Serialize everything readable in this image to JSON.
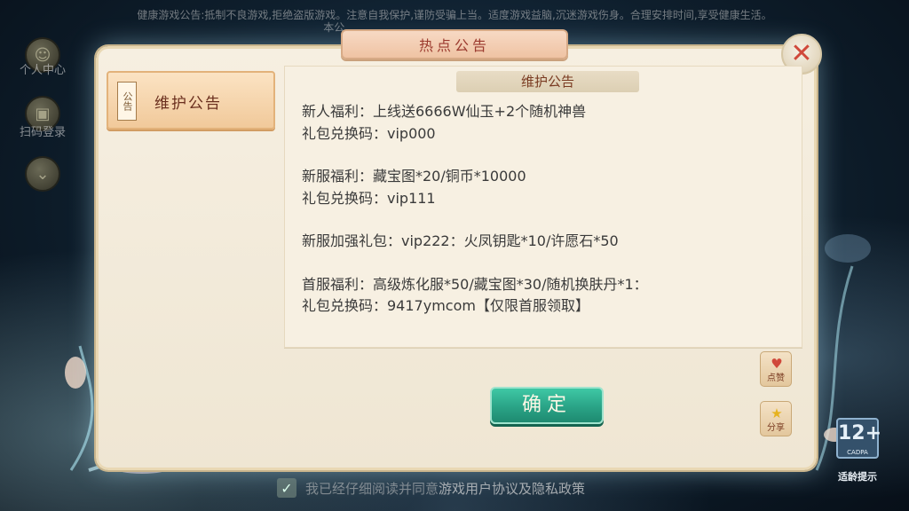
{
  "health_notice": {
    "line1": "健康游戏公告:抵制不良游戏,拒绝盗版游戏。注意自我保护,谨防受骗上当。适度游戏益脑,沉迷游戏伤身。合理安排时间,享受健康生活。",
    "line2": "本公..."
  },
  "side_menu": {
    "profile_label": "个人中心",
    "scan_label": "扫码登录"
  },
  "dialog": {
    "title": "热点公告",
    "close_symbol": "✕",
    "tab": {
      "stamp": "公告",
      "label": "维护公告"
    },
    "content_title": "维护公告",
    "lines": {
      "l1": "新人福利：上线送6666W仙玉+2个随机神兽",
      "l2": "礼包兑换码：vip000",
      "l3": "新服福利：藏宝图*20/铜币*10000",
      "l4": "礼包兑换码：vip111",
      "l5": "新服加强礼包：vip222：火凤钥匙*10/许愿石*50",
      "l6": "首服福利：高级炼化服*50/藏宝图*30/随机换肤丹*1：",
      "l7": "礼包兑换码：9417ymcom【仅限首服领取】"
    },
    "confirm_label": "确定",
    "like_label": "点赞",
    "share_label": "分享"
  },
  "rating": {
    "age": "12+",
    "org": "CADPA",
    "caption": "适龄提示"
  },
  "agreement": {
    "prefix": "我已经仔细阅读并同意",
    "link": "游戏用户协议及隐私政策"
  },
  "colors": {
    "title_text": "#9b3a2e",
    "confirm_bg": "#2aa386",
    "close_x": "#d0483a",
    "panel_bg": "#f7f0e2"
  },
  "icons": [
    "profile-icon",
    "scan-icon",
    "chevron-down-icon",
    "close-icon",
    "heart-icon",
    "star-icon"
  ]
}
